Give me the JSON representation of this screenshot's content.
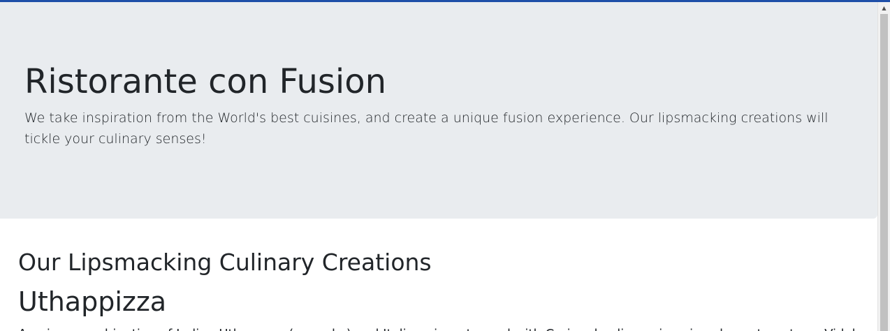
{
  "jumbotron": {
    "title": "Ristorante con Fusion",
    "lead": "We take inspiration from the World's best cuisines, and create a unique fusion experience. Our lipsmacking creations will tickle your culinary senses!"
  },
  "menu": {
    "heading": "Our Lipsmacking Culinary Creations",
    "dishes": [
      {
        "name": "Uthappizza",
        "description": "A unique combination of Indian Uthappam (pancake) and Italian pizza, topped with Cerignola olives, ripe vine cherry tomatoes, Vidalia"
      }
    ]
  },
  "scrollbar": {
    "up_arrow_icon": "triangle-up",
    "colors": {
      "track": "#f1f1f1",
      "thumb": "#c1c1c1"
    }
  },
  "colors": {
    "jumbotron_background": "#e9ecef",
    "top_border": "#1e4fa8",
    "text": "#212529"
  }
}
